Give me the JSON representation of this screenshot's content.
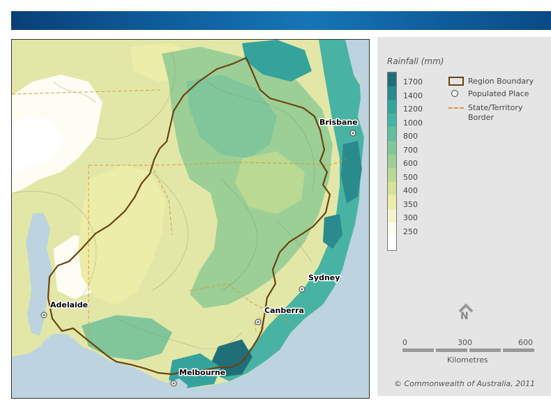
{
  "map": {
    "places": [
      {
        "name": "Brisbane"
      },
      {
        "name": "Sydney"
      },
      {
        "name": "Canberra"
      },
      {
        "name": "Adelaide"
      },
      {
        "name": "Melbourne"
      }
    ]
  },
  "legend": {
    "title": "Rainfall (mm)",
    "scale": [
      {
        "label": "1700",
        "color": "#1f6f78"
      },
      {
        "label": "1400",
        "color": "#2a8a8c"
      },
      {
        "label": "1200",
        "color": "#35a39c"
      },
      {
        "label": "1000",
        "color": "#48b3a3"
      },
      {
        "label": "800",
        "color": "#63bd9e"
      },
      {
        "label": "700",
        "color": "#80c69a"
      },
      {
        "label": "600",
        "color": "#9ccf96"
      },
      {
        "label": "500",
        "color": "#bad993"
      },
      {
        "label": "400",
        "color": "#d7e398"
      },
      {
        "label": "350",
        "color": "#eceda9"
      },
      {
        "label": "300",
        "color": "#f6f4cf"
      },
      {
        "label": "250",
        "color": "#fdfdf3"
      },
      {
        "label": "",
        "color": "#ffffff"
      }
    ],
    "keys": {
      "region_boundary": "Region Boundary",
      "populated_place": "Populated Place",
      "state_border_line1": "State/Territory",
      "state_border_line2": "Border"
    },
    "region_color": "#6b4312",
    "state_border_color": "#d99a3a"
  },
  "north": {
    "letter": "N"
  },
  "scalebar": {
    "ticks": [
      "0",
      "300",
      "600"
    ],
    "units": "Kilometres"
  },
  "copyright": "© Commonwealth of Australia, 2011"
}
